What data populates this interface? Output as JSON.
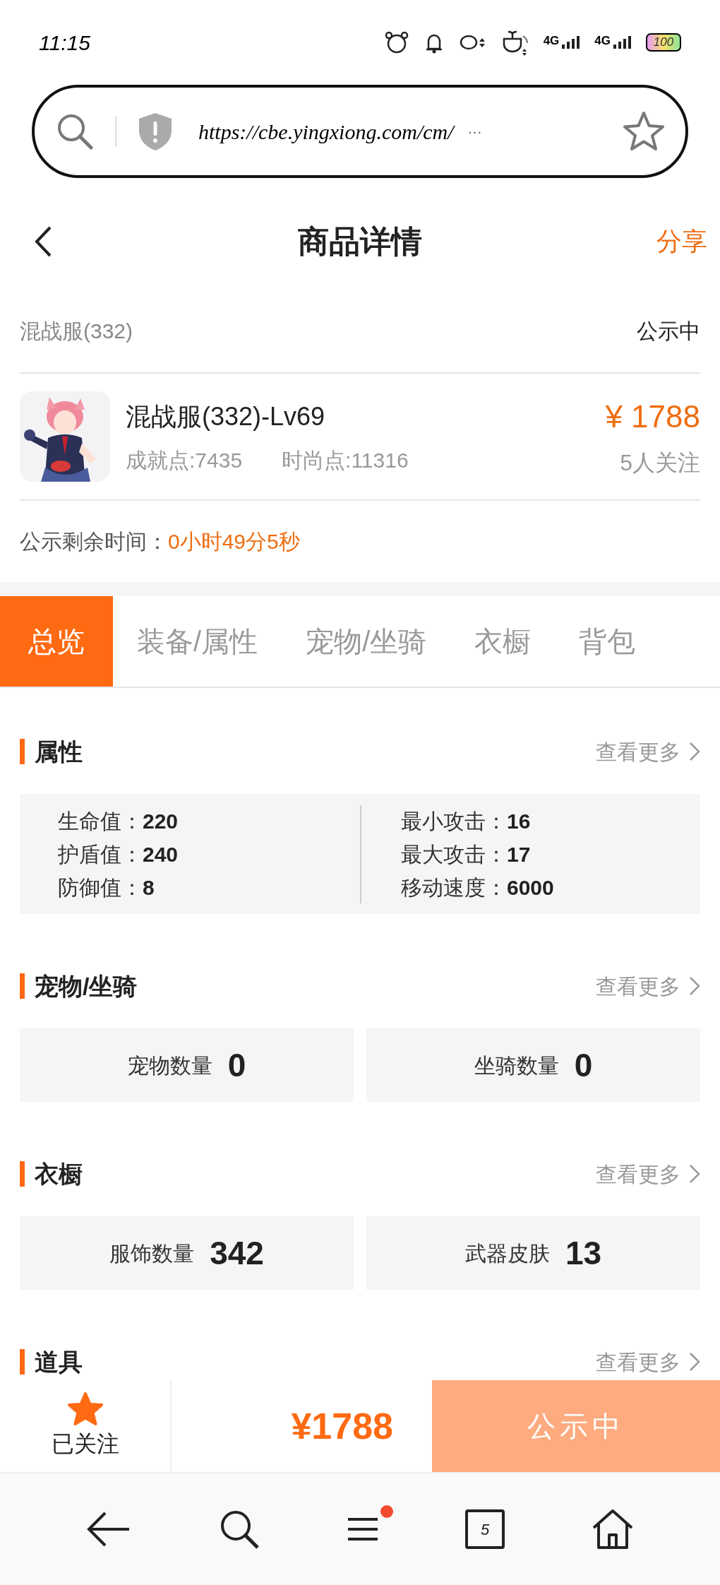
{
  "status_bar": {
    "time": "11:15",
    "network_1": "4G",
    "network_2": "4G",
    "battery": "100"
  },
  "address_bar": {
    "url": "https://cbe.yingxiong.com/cm/",
    "ellipsis": "···"
  },
  "header": {
    "title": "商品详情",
    "share": "分享"
  },
  "listing": {
    "server": "混战服(332)",
    "status": "公示中",
    "title": "混战服(332)-Lv69",
    "points": [
      "成就点:7435",
      "时尚点:11316"
    ],
    "price": "¥ 1788",
    "followers": "5人关注",
    "countdown_label": "公示剩余时间：",
    "countdown": "0小时49分5秒"
  },
  "tabs": [
    {
      "label": "总览",
      "selected": true
    },
    {
      "label": "装备/属性",
      "selected": false
    },
    {
      "label": "宠物/坐骑",
      "selected": false
    },
    {
      "label": "衣橱",
      "selected": false
    },
    {
      "label": "背包",
      "selected": false
    }
  ],
  "sections": [
    {
      "kind": "attributes",
      "title": "属性",
      "more": "查看更多",
      "left": [
        {
          "label": "生命值：",
          "value": "220"
        },
        {
          "label": "护盾值：",
          "value": "240"
        },
        {
          "label": "防御值：",
          "value": "8"
        }
      ],
      "right": [
        {
          "label": "最小攻击：",
          "value": "16"
        },
        {
          "label": "最大攻击：",
          "value": "17"
        },
        {
          "label": "移动速度：",
          "value": "6000"
        }
      ]
    },
    {
      "kind": "counts",
      "title": "宠物/坐骑",
      "more": "查看更多",
      "items": [
        {
          "label": "宠物数量",
          "value": "0"
        },
        {
          "label": "坐骑数量",
          "value": "0"
        }
      ]
    },
    {
      "kind": "counts",
      "title": "衣橱",
      "more": "查看更多",
      "items": [
        {
          "label": "服饰数量",
          "value": "342"
        },
        {
          "label": "武器皮肤",
          "value": "13"
        }
      ]
    },
    {
      "kind": "heading",
      "title": "道具",
      "more": "查看更多"
    }
  ],
  "action_bar": {
    "follow_label": "已关注",
    "followed": true,
    "price": "¥1788",
    "button": "公示中"
  },
  "nav": {
    "tab_count": "5",
    "menu_badge": true
  }
}
